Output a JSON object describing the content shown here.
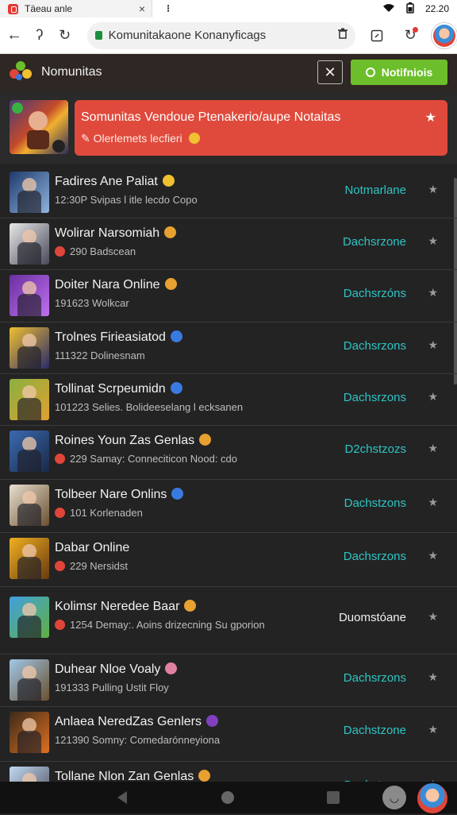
{
  "browser": {
    "tab_title": "Täeau anle",
    "tab_close": "×",
    "status_time": "22.20",
    "url": "Komunitakaone Konanyficags"
  },
  "app": {
    "title": "Nomunitas",
    "close_label": "✕",
    "notif_button": "Notifniois"
  },
  "banner": {
    "title": "Somunitas Vendoue Ptenakerio/aupe Notaitas",
    "subtitle": "Olerlemets lecfieri",
    "star": "★",
    "color": "#e04a3c"
  },
  "items": [
    {
      "title": "Fadires Ane Paliat",
      "meta": "12:30P   Svipas l itle lecdo Copo",
      "status": "Notmarlane",
      "thumb": [
        "#1f3a6b",
        "#8fb4e0"
      ],
      "emoji": "#f0c030",
      "badge": false
    },
    {
      "title": "Wolirar Narsomiah",
      "meta": "290    Badscean",
      "status": "Dachsrzone",
      "thumb": [
        "#e8e8e8",
        "#4a4a5a"
      ],
      "emoji": "#e8a030",
      "badge": true
    },
    {
      "title": "Doiter Nara Online",
      "meta": "191623   Wolkcar",
      "status": "Dachsrzóns",
      "thumb": [
        "#6a2fa0",
        "#c070f0"
      ],
      "emoji": "#e8a030",
      "badge": false
    },
    {
      "title": "Trolnes Firieasiatod",
      "meta": "111322   Dolinesnam",
      "status": "Dachsrzons",
      "thumb": [
        "#f0c030",
        "#2a2a6a"
      ],
      "emoji": "#3a7ae0",
      "badge": false
    },
    {
      "title": "Tollinat Scrpeumidn",
      "meta": "101223   Selies. Bolideeselang l ecksanen",
      "status": "Dachsrzons",
      "thumb": [
        "#8ab040",
        "#e0a030"
      ],
      "emoji": "#3a7ae0",
      "badge": false
    },
    {
      "title": "Roines Youn Zas Genlas",
      "meta": "229   Samay: Conneciticon Nood: cdo",
      "status": "D2chstzozs",
      "thumb": [
        "#3a6ab0",
        "#1a2a4a"
      ],
      "emoji": "#e8a030",
      "badge": true
    },
    {
      "title": "Tolbeer Nare Onlins",
      "meta": "101   Korlenaden",
      "status": "Dachstzons",
      "thumb": [
        "#e8e0d0",
        "#6a5030"
      ],
      "emoji": "#3a7ae0",
      "badge": true
    },
    {
      "title": "Dabar Online",
      "meta": "229    Nersidst",
      "status": "Dachsrzons",
      "thumb": [
        "#f0b020",
        "#6a3a10"
      ],
      "emoji": "",
      "badge": true
    },
    {
      "title": "Kolimsr Neredee Baar",
      "meta": "1254   Demay:. Aoins drizecning Su gporion",
      "status": "Duomstóane",
      "thumb": [
        "#40a0e0",
        "#60b040"
      ],
      "emoji": "#e8a030",
      "badge": true,
      "plain": true
    },
    {
      "title": "Duhear Nloe Voaly",
      "meta": "191333   Pulling Ustit Floy",
      "status": "Dachsrzons",
      "thumb": [
        "#a0c8e8",
        "#6a5030"
      ],
      "emoji": "#e080a0",
      "badge": false
    },
    {
      "title": "Anlaea NeredZas Genlers",
      "meta": "121390   Somny: Comedarónneyiona",
      "status": "Dachstzone",
      "thumb": [
        "#3a2a1a",
        "#e07020"
      ],
      "emoji": "#8040c0",
      "badge": false
    },
    {
      "title": "Tollane Nlon Zan Genlas",
      "meta": "",
      "status": "Dachstzons",
      "thumb": [
        "#c0d8f0",
        "#4a4a5a"
      ],
      "emoji": "#e8a030",
      "badge": false
    }
  ]
}
